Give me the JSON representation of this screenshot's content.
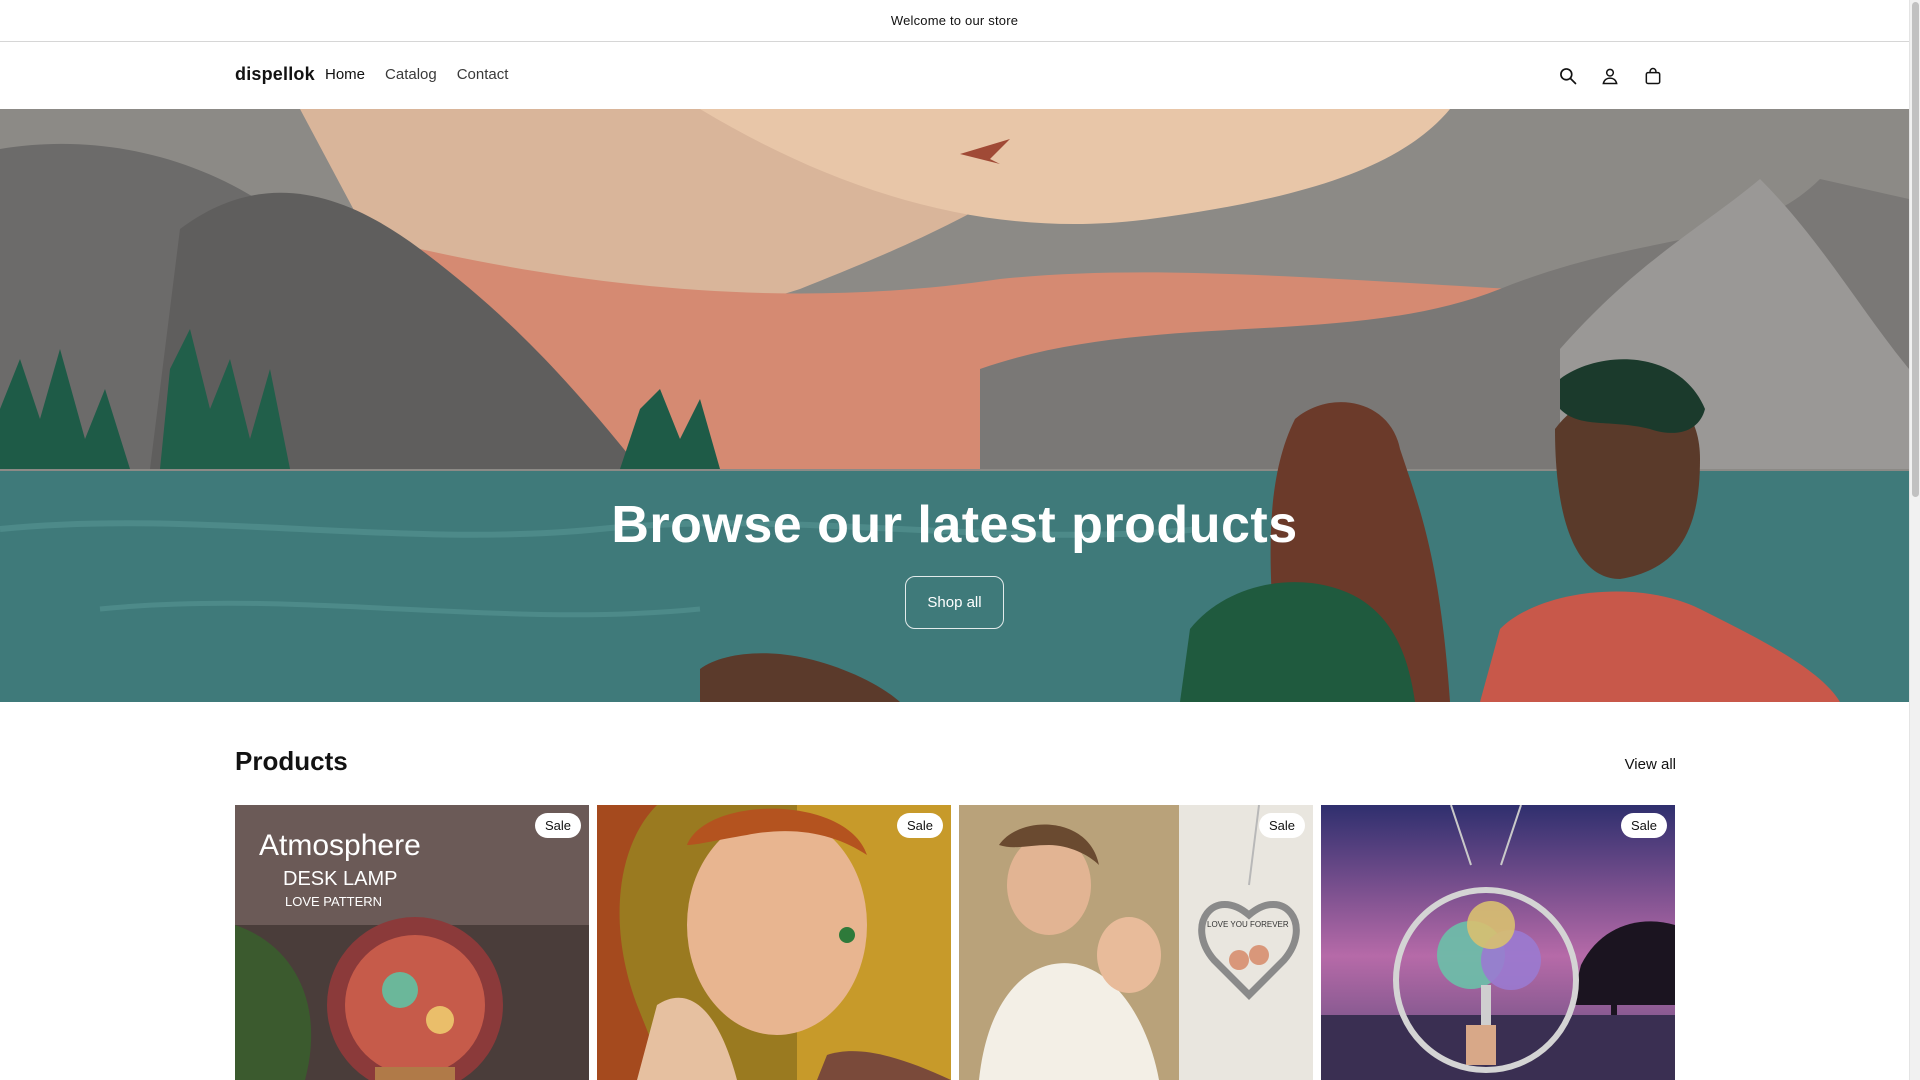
{
  "announcement": {
    "text": "Welcome to our store"
  },
  "header": {
    "logo": "dispellok",
    "nav": [
      {
        "label": "Home",
        "active": true
      },
      {
        "label": "Catalog",
        "active": false
      },
      {
        "label": "Contact",
        "active": false
      }
    ],
    "icons": [
      "search-icon",
      "account-icon",
      "cart-icon"
    ]
  },
  "hero": {
    "title": "Browse our latest products",
    "button_label": "Shop all"
  },
  "products": {
    "title": "Products",
    "view_all_label": "View all",
    "items": [
      {
        "badge": "Sale",
        "image_text_1": "Atmosphere",
        "image_text_2": "DESK LAMP",
        "image_text_3": "LOVE PATTERN"
      },
      {
        "badge": "Sale"
      },
      {
        "badge": "Sale",
        "image_text_1": "LOVE YOU FOREVER"
      },
      {
        "badge": "Sale"
      }
    ]
  },
  "colors": {
    "text": "#121212",
    "hero_sky": "#8a8885",
    "hero_water": "#3f7a7a",
    "hero_trees": "#1e5b47",
    "sale_badge_bg": "#ffffff"
  }
}
